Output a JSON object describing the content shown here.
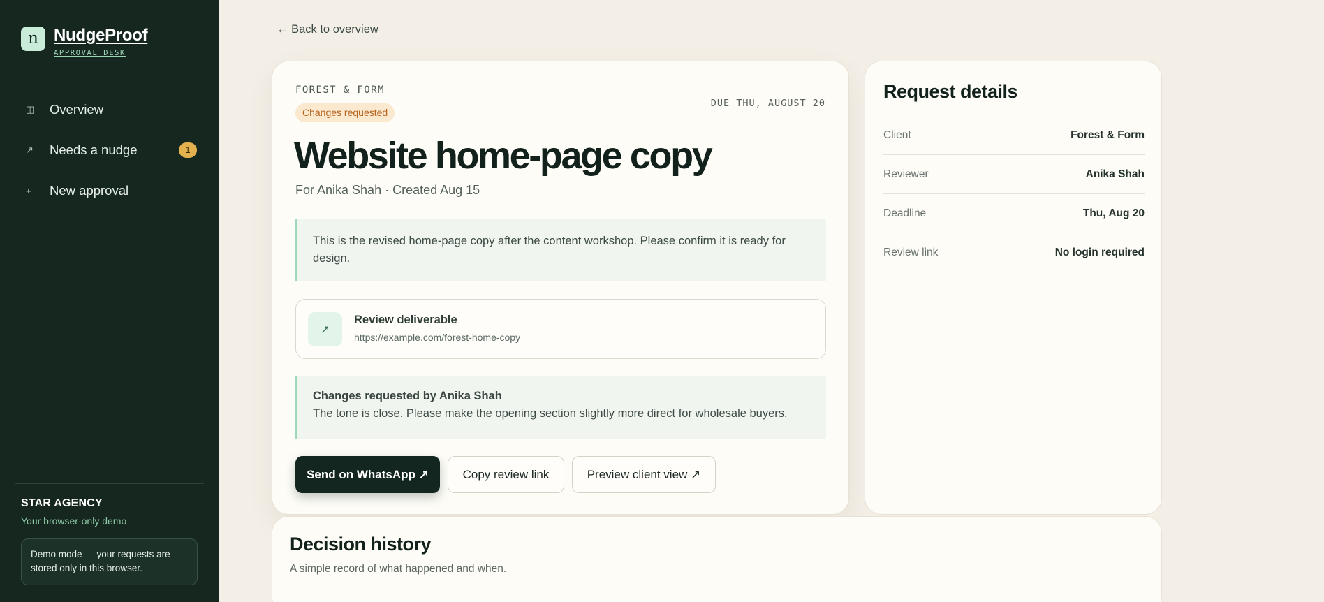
{
  "sidebar": {
    "brand_mark": "n",
    "brand_name": "NudgeProof",
    "brand_sub": "APPROVAL DESK",
    "nav": [
      {
        "icon": "columns-icon",
        "glyph": "◫",
        "label": "Overview"
      },
      {
        "icon": "arrow-up-right-icon",
        "glyph": "↗",
        "label": "Needs a nudge",
        "badge": "1"
      },
      {
        "icon": "plus-icon",
        "glyph": "+",
        "label": "New approval"
      }
    ],
    "agency_name": "STAR AGENCY",
    "agency_sub": "Your browser-only demo",
    "demo_note": "Demo mode — your requests are stored only in this browser."
  },
  "back_link": "← Back to overview",
  "request": {
    "client": "FOREST & FORM",
    "status": "Changes requested",
    "due": "DUE THU, AUGUST 20",
    "title": "Website home-page copy",
    "meta": "For Anika Shah · Created Aug 15",
    "note": "This is the revised home-page copy after the content workshop. Please confirm it is ready for design.",
    "deliverable": {
      "icon": "arrow-up-right-icon",
      "glyph": "↗",
      "title": "Review deliverable",
      "url": "https://example.com/forest-home-copy"
    },
    "change_request": {
      "title": "Changes requested by Anika Shah",
      "body": "The tone is close. Please make the opening section slightly more direct for wholesale buyers."
    },
    "actions": {
      "whatsapp": "Send on WhatsApp ↗",
      "copy": "Copy review link",
      "preview": "Preview client view ↗"
    }
  },
  "details": {
    "title": "Request details",
    "rows": [
      {
        "key": "Client",
        "value": "Forest & Form"
      },
      {
        "key": "Reviewer",
        "value": "Anika Shah"
      },
      {
        "key": "Deadline",
        "value": "Thu, Aug 20"
      },
      {
        "key": "Review link",
        "value": "No login required"
      }
    ]
  },
  "history": {
    "title": "Decision history",
    "subtitle": "A simple record of what happened and when."
  },
  "colors": {
    "sidebar_bg": "#15271f",
    "page_bg": "#f4efe6",
    "accent_green": "#9dd9b8",
    "status_orange": "#b5641d",
    "badge_yellow": "#e3b24e"
  }
}
